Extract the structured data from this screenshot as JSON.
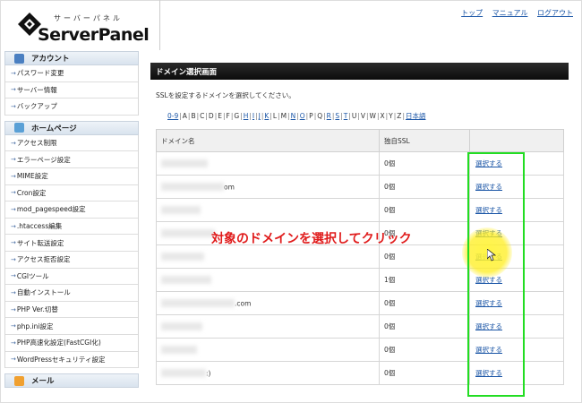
{
  "header": {
    "kana": "サーバーパネル",
    "logo": "ServerPanel",
    "links": [
      "トップ",
      "マニュアル",
      "ログアウト"
    ]
  },
  "sidebar": {
    "sections": [
      {
        "title": "アカウント",
        "icon": "user-icon",
        "color": "#4a7fc1",
        "items": [
          "パスワード変更",
          "サーバー情報",
          "バックアップ"
        ]
      },
      {
        "title": "ホームページ",
        "icon": "homepage-icon",
        "color": "#5aa0d6",
        "items": [
          "アクセス制限",
          "エラーページ設定",
          "MIME設定",
          "Cron設定",
          "mod_pagespeed設定",
          ".htaccess編集",
          "サイト転送設定",
          "アクセス拒否設定",
          "CGIツール",
          "自動インストール",
          "PHP Ver.切替",
          "php.ini設定",
          "PHP高速化設定(FastCGI化)",
          "WordPressセキュリティ設定"
        ]
      },
      {
        "title": "メール",
        "icon": "mail-icon",
        "color": "#f0a030",
        "items": []
      }
    ]
  },
  "main": {
    "title": "ドメイン選択画面",
    "description": "SSLを設定するドメインを選択してください。",
    "alphabet": [
      "0-9",
      "A",
      "B",
      "C",
      "D",
      "E",
      "F",
      "G",
      "H",
      "I",
      "J",
      "K",
      "L",
      "M",
      "N",
      "O",
      "P",
      "Q",
      "R",
      "S",
      "T",
      "U",
      "V",
      "W",
      "X",
      "Y",
      "Z",
      "日本語"
    ],
    "alphabet_links": [
      "0-9",
      "H",
      "I",
      "J",
      "K",
      "N",
      "O",
      "R",
      "S",
      "T",
      "日本語"
    ],
    "columns": [
      "ドメイン名",
      "独自SSL",
      ""
    ],
    "rows": [
      {
        "domain_suffix": "",
        "ssl": "0個",
        "action": "選択する"
      },
      {
        "domain_suffix": "om",
        "ssl": "0個",
        "action": "選択する"
      },
      {
        "domain_suffix": "",
        "ssl": "0個",
        "action": "選択する"
      },
      {
        "domain_suffix": "",
        "ssl": "0個",
        "action": "選択する"
      },
      {
        "domain_suffix": "",
        "ssl": "0個",
        "action": "選択する"
      },
      {
        "domain_suffix": "",
        "ssl": "1個",
        "action": "選択する"
      },
      {
        "domain_suffix": ".com",
        "ssl": "0個",
        "action": "選択する"
      },
      {
        "domain_suffix": "",
        "ssl": "0個",
        "action": "選択する"
      },
      {
        "domain_suffix": "",
        "ssl": "0個",
        "action": "選択する"
      },
      {
        "domain_suffix": ":)",
        "ssl": "0個",
        "action": "選択する"
      }
    ]
  },
  "annotation": {
    "callout": "対象のドメインを選択してクリック",
    "highlight_color": "#22dd22",
    "callout_color": "#e01b1b"
  }
}
